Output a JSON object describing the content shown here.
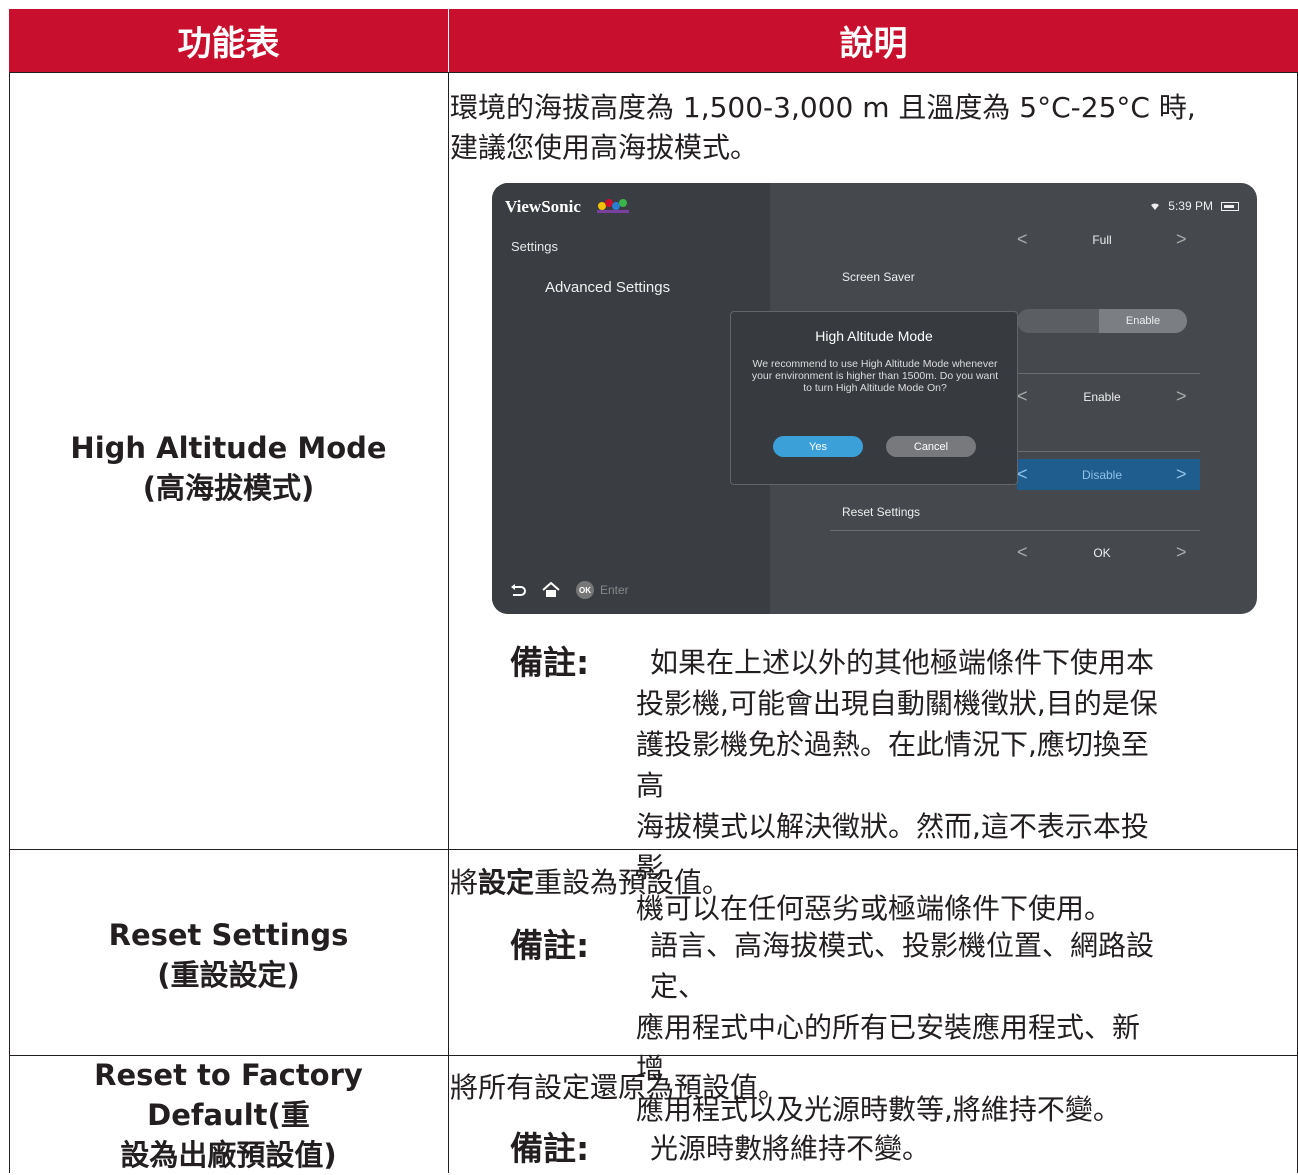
{
  "header": {
    "col1": "功能表",
    "col2": "說明"
  },
  "rows": [
    {
      "feature_en": "High Altitude Mode",
      "feature_zh": "(高海拔模式)",
      "desc_line1": "環境的海拔高度為 1,500-3,000 m 且溫度為 5°C-25°C 時,",
      "desc_line2": "建議您使用高海拔模式。",
      "note_label": "備註:",
      "note_lines": [
        "如果在上述以外的其他極端條件下使用本",
        "投影機,可能會出現自動關機徵狀,目的是保",
        "護投影機免於過熱。在此情況下,應切換至高",
        "海拔模式以解決徵狀。然而,這不表示本投影",
        "機可以在任何惡劣或極端條件下使用。"
      ]
    },
    {
      "feature_en": "Reset Settings",
      "feature_zh": "(重設設定)",
      "desc_pre": "將",
      "desc_bold": "設定",
      "desc_post": "重設為預設值。",
      "note_label": "備註:",
      "note_lines": [
        "語言、高海拔模式、投影機位置、網路設定、",
        "應用程式中心的所有已安裝應用程式、新增",
        "應用程式以及光源時數等,將維持不變。"
      ]
    },
    {
      "feature_en": "Reset to Factory Default(重",
      "feature_zh": "設為出廠預設值)",
      "desc": "將所有設定還原為預設值。",
      "note_label": "備註:",
      "note_lines": [
        "光源時數將維持不變。"
      ]
    }
  ],
  "screenshot": {
    "brand": "ViewSonic",
    "time": "5:39 PM",
    "breadcrumb1": "Settings",
    "breadcrumb2": "Advanced Settings",
    "row1_value": "Full",
    "screen_saver_label": "Screen Saver",
    "toggle_value": "Enable",
    "row3_value": "Enable",
    "row4_value": "Disable",
    "reset_label": "Reset Settings",
    "row5_value": "OK",
    "bottom_ok": "OK",
    "bottom_enter": "Enter",
    "dialog": {
      "title": "High Altitude Mode",
      "message": "We recommend to use High Altitude Mode whenever your environment is higher than 1500m. Do you want to turn High Altitude Mode On?",
      "yes": "Yes",
      "cancel": "Cancel"
    }
  }
}
